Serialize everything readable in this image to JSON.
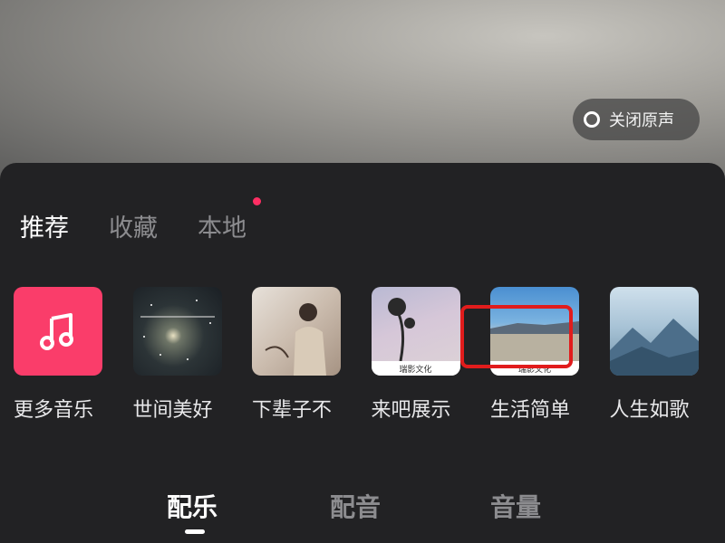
{
  "overlay": {
    "close_original_label": "关闭原声"
  },
  "tabs": [
    {
      "label": "推荐",
      "active": true
    },
    {
      "label": "收藏",
      "active": false
    },
    {
      "label": "本地",
      "active": false,
      "has_dot": true
    }
  ],
  "tracks": [
    {
      "title": "更多音乐",
      "icon": "music-note-icon"
    },
    {
      "title": "世间美好"
    },
    {
      "title": "下辈子不"
    },
    {
      "title": "来吧展示",
      "brand": "瑞影文化"
    },
    {
      "title": "生活简单",
      "brand": "瑞影文化"
    },
    {
      "title": "人生如歌"
    }
  ],
  "bottom_nav": [
    {
      "label": "配乐",
      "active": true
    },
    {
      "label": "配音",
      "active": false
    },
    {
      "label": "音量",
      "active": false,
      "highlighted": true
    }
  ],
  "colors": {
    "accent": "#fa3d6a",
    "highlight": "#e11c1c",
    "panel": "#222224"
  }
}
